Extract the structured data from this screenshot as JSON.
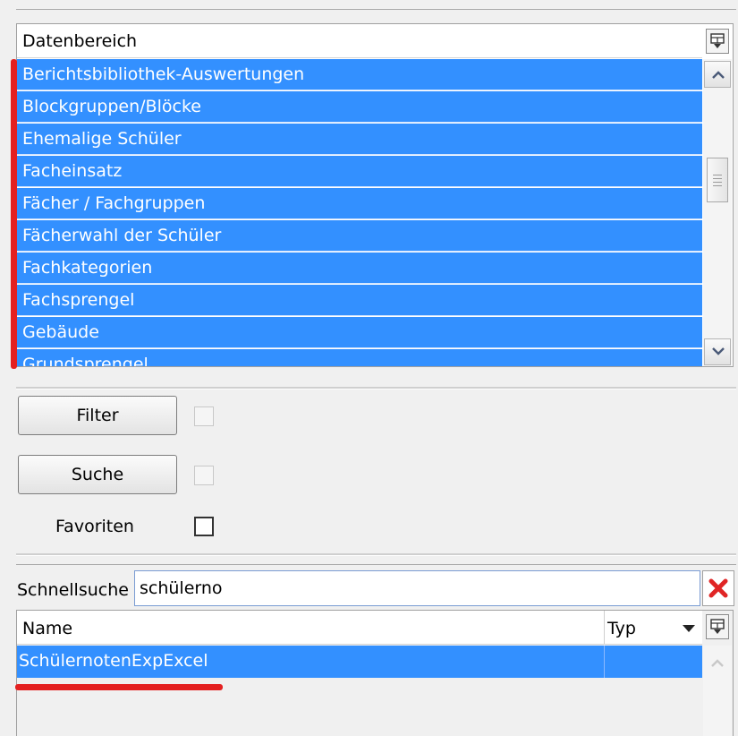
{
  "datenbereich": {
    "header": "Datenbereich",
    "items": [
      "Berichtsbibliothek-Auswertungen",
      "Blockgruppen/Blöcke",
      "Ehemalige Schüler",
      "Facheinsatz",
      "Fächer / Fachgruppen",
      "Fächerwahl der Schüler",
      "Fachkategorien",
      "Fachsprengel",
      "Gebäude",
      "Grundsprengel"
    ]
  },
  "controls": {
    "filter_label": "Filter",
    "suche_label": "Suche",
    "favoriten_label": "Favoriten"
  },
  "quicksearch": {
    "label": "Schnellsuche",
    "value": "schülerno"
  },
  "results": {
    "columns": [
      "Name",
      "Typ"
    ],
    "rows": [
      {
        "name": "SchülernotenExpExcel",
        "typ": ""
      }
    ]
  },
  "colors": {
    "selection": "#3390ff",
    "annotation": "#e42020"
  },
  "icons": {
    "column_chooser": "column-chooser-icon",
    "clear": "red-x-icon",
    "scroll_up": "chevron-up-icon",
    "scroll_down": "chevron-down-icon"
  }
}
